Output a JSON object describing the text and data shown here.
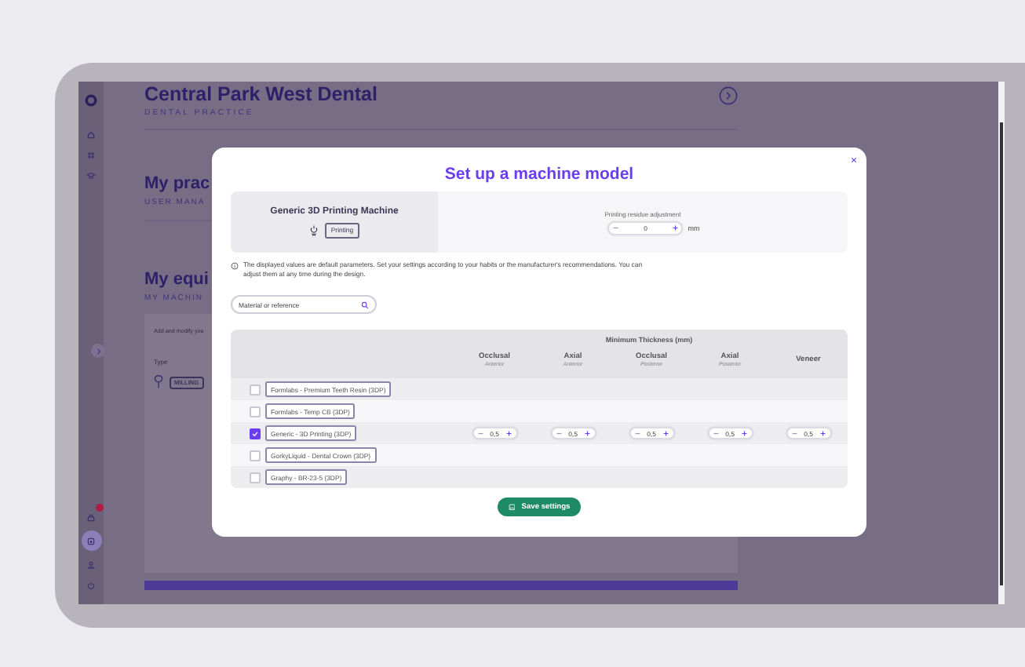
{
  "sidebar": {
    "top_items": [
      {
        "kind": "home",
        "selected": false
      },
      {
        "kind": "grid",
        "selected": false
      },
      {
        "kind": "cap",
        "selected": false
      }
    ],
    "bottom_items": [
      {
        "kind": "box",
        "selected": false,
        "alert": true
      },
      {
        "kind": "machine",
        "selected": true,
        "alert": false
      },
      {
        "kind": "user",
        "selected": false,
        "alert": false
      },
      {
        "kind": "power",
        "selected": false,
        "alert": false
      }
    ]
  },
  "page": {
    "title": "Central Park West Dental",
    "subtitle": "DENTAL PRACTICE",
    "sections": [
      {
        "title": "My prac",
        "subtitle": "USER MANA"
      },
      {
        "title": "My equi",
        "subtitle": "MY MACHIN"
      }
    ],
    "panel": {
      "intro": "Add and modify you",
      "column": "Type",
      "rows": [
        {
          "tag": "MILLING"
        }
      ]
    }
  },
  "modal": {
    "title": "Set up a machine model",
    "machine": {
      "name": "Generic 3D Printing Machine",
      "tag": "Printing"
    },
    "adjustment": {
      "label": "Printing residue adjustment",
      "value": "0",
      "unit": "mm"
    },
    "info": "The displayed values are default parameters. Set your settings according to your habits or the manufacturer's recommendations. You can adjust them at any time during the design.",
    "search": {
      "placeholder": "Material or reference"
    },
    "table": {
      "group": "Minimum Thickness (mm)",
      "columns": [
        {
          "name": "Occlusal",
          "sub": "Anterior"
        },
        {
          "name": "Axial",
          "sub": "Anterior"
        },
        {
          "name": "Occlusal",
          "sub": "Posterior"
        },
        {
          "name": "Axial",
          "sub": "Posterior"
        },
        {
          "name": "Veneer"
        }
      ],
      "rows": [
        {
          "material": "Formlabs - Premium Teeth Resin (3DP)",
          "checked": false
        },
        {
          "material": "Formlabs - Temp CB (3DP)",
          "checked": false
        },
        {
          "material": "Generic - 3D Printing (3DP)",
          "checked": true,
          "values": [
            "0,5",
            "0,5",
            "0,5",
            "0,5",
            "0,5"
          ]
        },
        {
          "material": "GorkyLiquid - Dental Crown (3DP)",
          "checked": false
        },
        {
          "material": "Graphy - BR-23-5 (3DP)",
          "checked": false
        }
      ]
    },
    "save": "Save settings"
  }
}
